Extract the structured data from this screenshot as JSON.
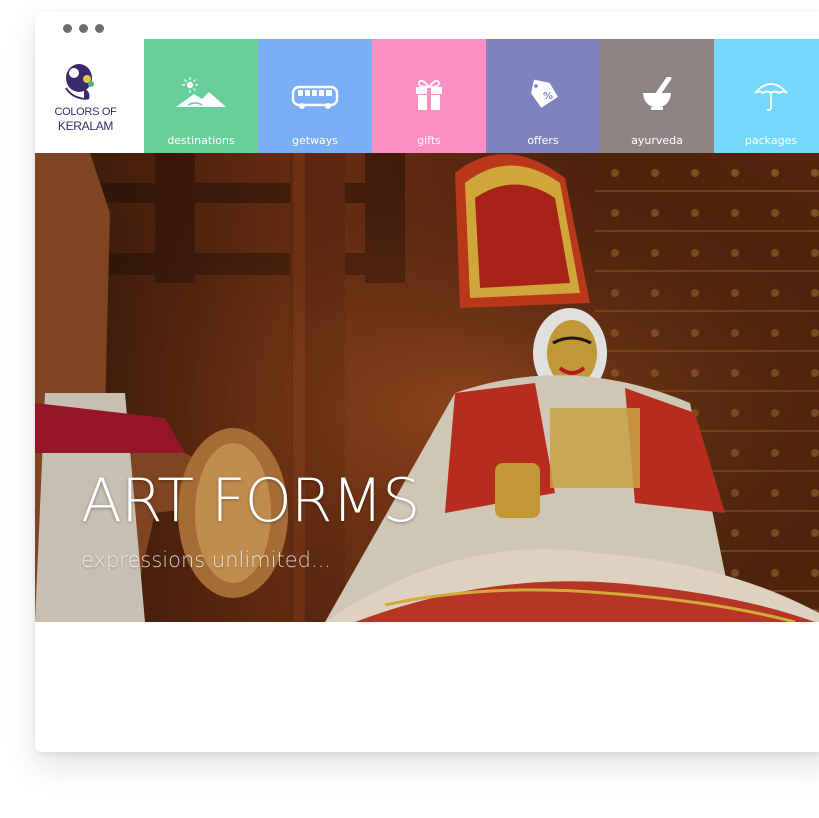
{
  "window": {
    "controls": [
      "dot",
      "dot",
      "dot"
    ]
  },
  "logo": {
    "line1": "COLORS OF",
    "line2": "KERALAM"
  },
  "nav": {
    "tiles": [
      {
        "label": "destinations",
        "icon": "mountain-sun-icon",
        "color": "#66cf9a"
      },
      {
        "label": "getways",
        "icon": "bus-icon",
        "color": "#7aaef6"
      },
      {
        "label": "gifts",
        "icon": "gift-box-icon",
        "color": "#fd8fc3"
      },
      {
        "label": "offers",
        "icon": "percent-tag-icon",
        "color": "#7e82bf"
      },
      {
        "label": "ayurveda",
        "icon": "mortar-pestle-icon",
        "color": "#8d8584"
      },
      {
        "label": "packages",
        "icon": "umbrella-icon",
        "color": "#75d7fc"
      }
    ]
  },
  "hero": {
    "title": "ART FORMS",
    "subtitle": "expressions unlimited..."
  }
}
